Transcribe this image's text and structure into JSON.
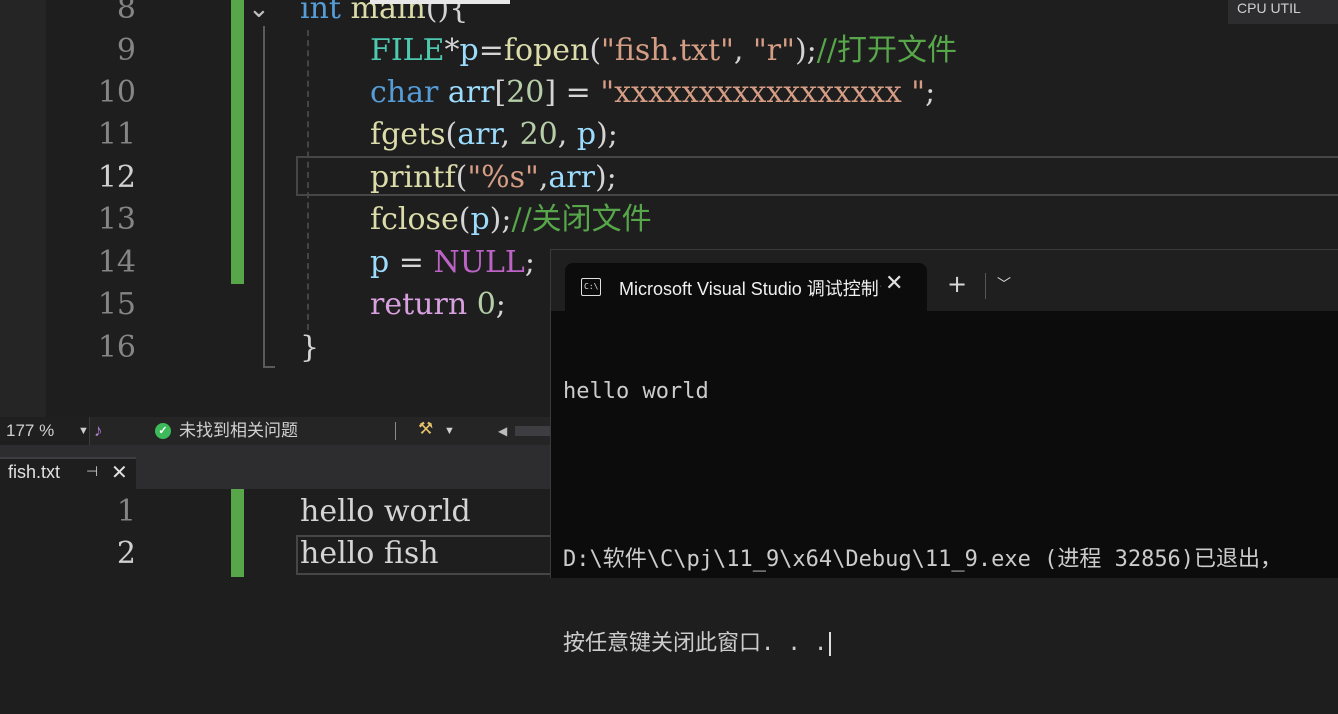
{
  "editor": {
    "lines": [
      {
        "num": "8",
        "current": false
      },
      {
        "num": "9",
        "current": false
      },
      {
        "num": "10",
        "current": false
      },
      {
        "num": "11",
        "current": false
      },
      {
        "num": "12",
        "current": true
      },
      {
        "num": "13",
        "current": false
      },
      {
        "num": "14",
        "current": false
      },
      {
        "num": "15",
        "current": false
      },
      {
        "num": "16",
        "current": false
      }
    ],
    "code": {
      "l8_kw": "int",
      "l8_func": "main",
      "l8_rest": "(){",
      "l9": [
        "FILE",
        "*",
        "p",
        "=",
        "fopen",
        "(",
        "\"fish.txt\"",
        ", ",
        "\"r\"",
        ");",
        "//打开文件"
      ],
      "l10": [
        "char",
        " ",
        "arr",
        "[",
        "20",
        "] = ",
        "\"xxxxxxxxxxxxxxxxx \"",
        ";"
      ],
      "l11": [
        "fgets",
        "(",
        "arr",
        ", ",
        "20",
        ", ",
        "p",
        ");"
      ],
      "l12": [
        "printf",
        "(",
        "\"%s\"",
        ",",
        "arr",
        ");"
      ],
      "l13": [
        "fclose",
        "(",
        "p",
        ");",
        "//关闭文件"
      ],
      "l14": [
        "p",
        " = ",
        "NULL",
        ";"
      ],
      "l15": [
        "return",
        " ",
        "0",
        ";"
      ],
      "l16": "}"
    }
  },
  "top_right": {
    "label": "CPU UTIL"
  },
  "statusbar": {
    "zoom": "177 %",
    "issues": "未找到相关问题"
  },
  "doc_tab": {
    "label": "fish.txt"
  },
  "fish_file": {
    "lines": [
      {
        "num": "1",
        "text": "hello world"
      },
      {
        "num": "2",
        "text": "hello fish"
      }
    ]
  },
  "console": {
    "tab_title": "Microsoft Visual Studio 调试控制台",
    "new_tab": "+",
    "output": [
      "hello world",
      "",
      "D:\\软件\\C\\pj\\11_9\\x64\\Debug\\11_9.exe (进程 32856)已退出，",
      "按任意键关闭此窗口. . ."
    ]
  },
  "colors": {
    "background": "#1e1e1e",
    "change_bar": "#57a64a",
    "comment": "#57a64a",
    "string": "#d69d85",
    "keyword": "#569cd6",
    "type": "#4ec9b0",
    "function": "#dcdcaa",
    "variable": "#9cdcfe",
    "macro": "#bd63c5",
    "console_bg": "#0c0c0c"
  },
  "icons": [
    "chevron-down-icon",
    "intellicode-icon",
    "check-circle-icon",
    "broom-icon",
    "pin-icon",
    "close-icon",
    "cmd-icon",
    "plus-icon"
  ]
}
